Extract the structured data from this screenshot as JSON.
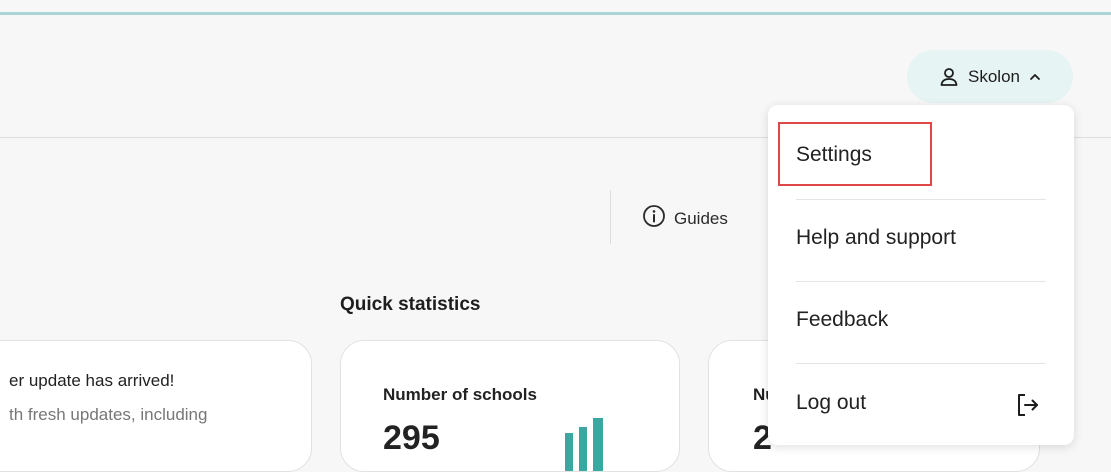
{
  "header": {
    "user_name": "Skolon"
  },
  "user_menu": {
    "items": [
      "Settings",
      "Help and support",
      "Feedback",
      "Log out"
    ],
    "highlighted_item": "Settings"
  },
  "toolbar": {
    "guides_label": "Guides"
  },
  "quick_statistics": {
    "title": "Quick statistics",
    "news_card": {
      "headline": "er update has arrived!",
      "body": "th fresh updates, including"
    },
    "schools_card": {
      "label": "Number of schools",
      "value": "295"
    },
    "third_card": {
      "label": "Nu",
      "value": "2"
    }
  },
  "colors": {
    "accent_teal": "#3aa7a0",
    "pill_background": "#e6f4f3",
    "highlight_red": "#e04848"
  },
  "icons": [
    "user-icon",
    "chevron-up-icon",
    "info-icon",
    "logout-icon"
  ]
}
